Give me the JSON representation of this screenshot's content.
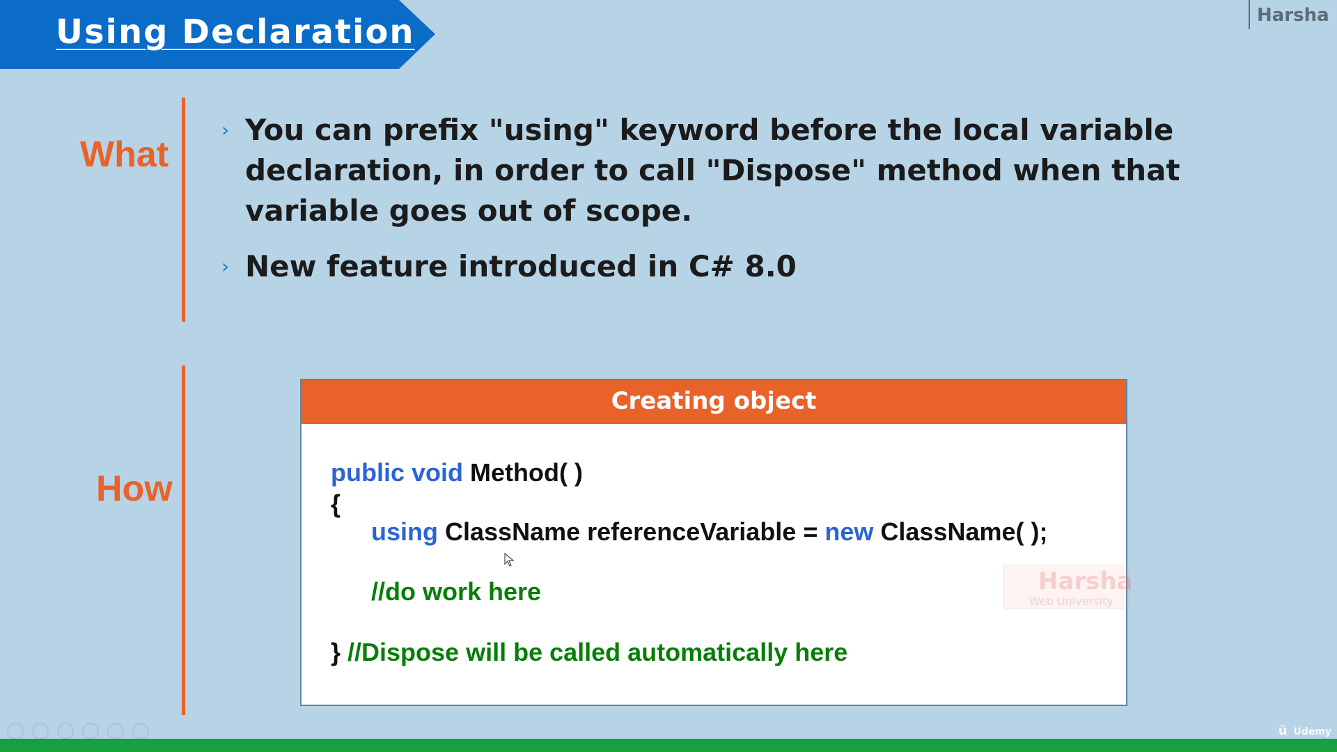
{
  "header": {
    "title": "Using Declaration",
    "brand_top": "Harsha"
  },
  "sections": {
    "what_label": "What",
    "how_label": "How"
  },
  "bullets": [
    {
      "marker": "›",
      "text": "You can prefix \"using\" keyword before the local variable declaration, in order to call \"Dispose\" method when that variable goes out of scope."
    },
    {
      "marker": "›",
      "text": "New feature introduced in C# 8.0"
    }
  ],
  "code_panel": {
    "title": "Creating object",
    "line_1_kw_1": "public",
    "line_1_kw_2": "void",
    "line_1_text": "Method( )",
    "line_2_text": "{",
    "line_3_kw_1": "using",
    "line_3_text_1": "ClassName  referenceVariable = ",
    "line_3_kw_2": "new",
    "line_3_text_2": " ClassName( );",
    "line_4_comment": "//do work here",
    "line_5_text": "}",
    "line_5_comment": " //Dispose will be called automatically here"
  },
  "watermark": {
    "main": "Harsha",
    "sub": "Web University"
  },
  "footer": {
    "brand": "Udemy"
  },
  "colors": {
    "background": "#b7d3e6",
    "title_blue": "#0a6cc7",
    "accent_orange": "#e8622a",
    "keyword_blue": "#2d64d5",
    "comment_green": "#087d08",
    "bottom_bar_green": "#15a13f"
  },
  "icons": {
    "cursor": "cursor-arrow-icon",
    "controls": [
      "previous-icon",
      "next-icon",
      "pen-icon",
      "copy-icon",
      "search-icon",
      "more-icon"
    ]
  }
}
